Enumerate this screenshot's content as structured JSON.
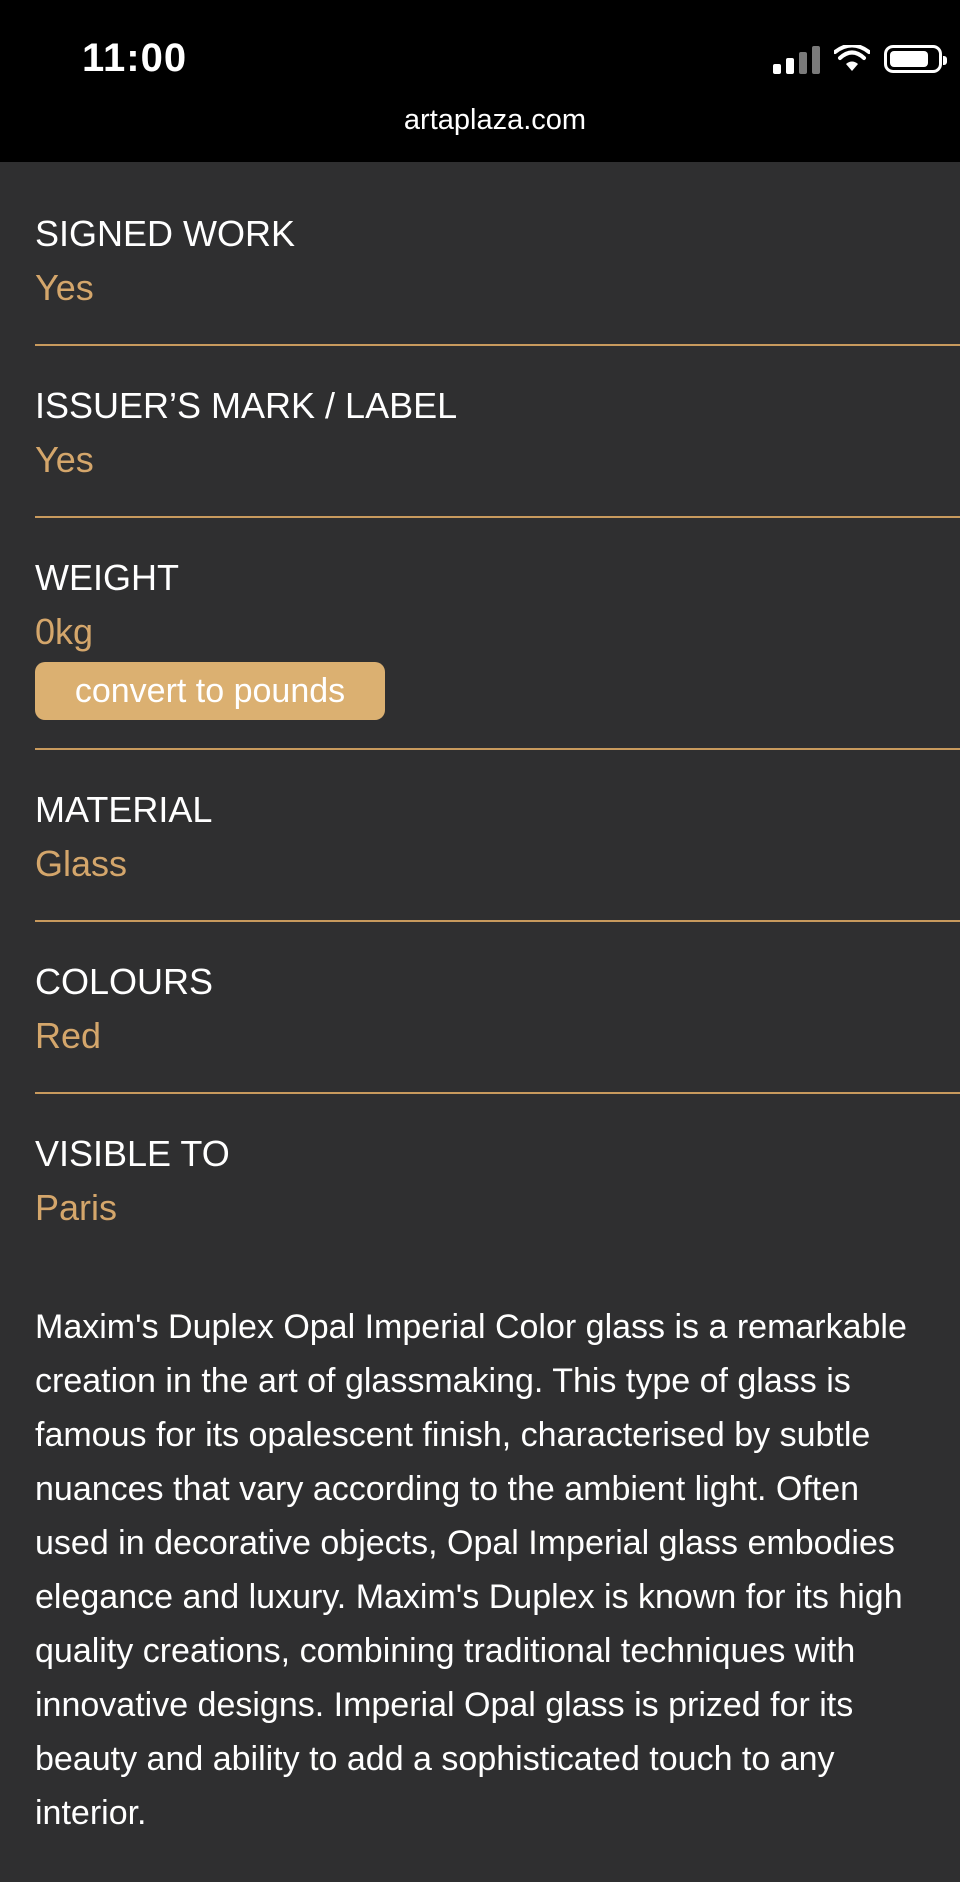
{
  "status_bar": {
    "time": "11:00",
    "url": "artaplaza.com",
    "icons": [
      "signal-icon",
      "wifi-icon",
      "battery-icon"
    ]
  },
  "colors": {
    "background": "#2f2f30",
    "accent": "#d4a66b",
    "button": "#dbb071",
    "divider": "#c89a5d"
  },
  "fields": {
    "signed_work": {
      "label": "SIGNED WORK",
      "value": "Yes"
    },
    "issuer_mark": {
      "label": "ISSUER’S MARK / LABEL",
      "value": "Yes"
    },
    "weight": {
      "label": "WEIGHT",
      "value": "0kg",
      "convert_label": "convert to pounds"
    },
    "material": {
      "label": "MATERIAL",
      "value": "Glass"
    },
    "colours": {
      "label": "COLOURS",
      "value": "Red"
    },
    "visible_to": {
      "label": "VISIBLE TO",
      "value": "Paris"
    }
  },
  "description_lines": [
    "Maxim's Duplex Opal Imperial Color glass is a remarkable",
    "creation in the art of glassmaking. This type of glass is",
    "famous for its opalescent finish, characterised by subtle",
    "nuances that vary according to the ambient light. Often",
    "used in decorative objects, Opal Imperial glass embodies",
    "elegance and luxury. Maxim's Duplex is known for its high",
    "quality creations, combining traditional techniques with",
    "innovative designs. Imperial Opal glass is prized for its",
    "beauty and ability to add a sophisticated touch to any",
    "interior."
  ]
}
